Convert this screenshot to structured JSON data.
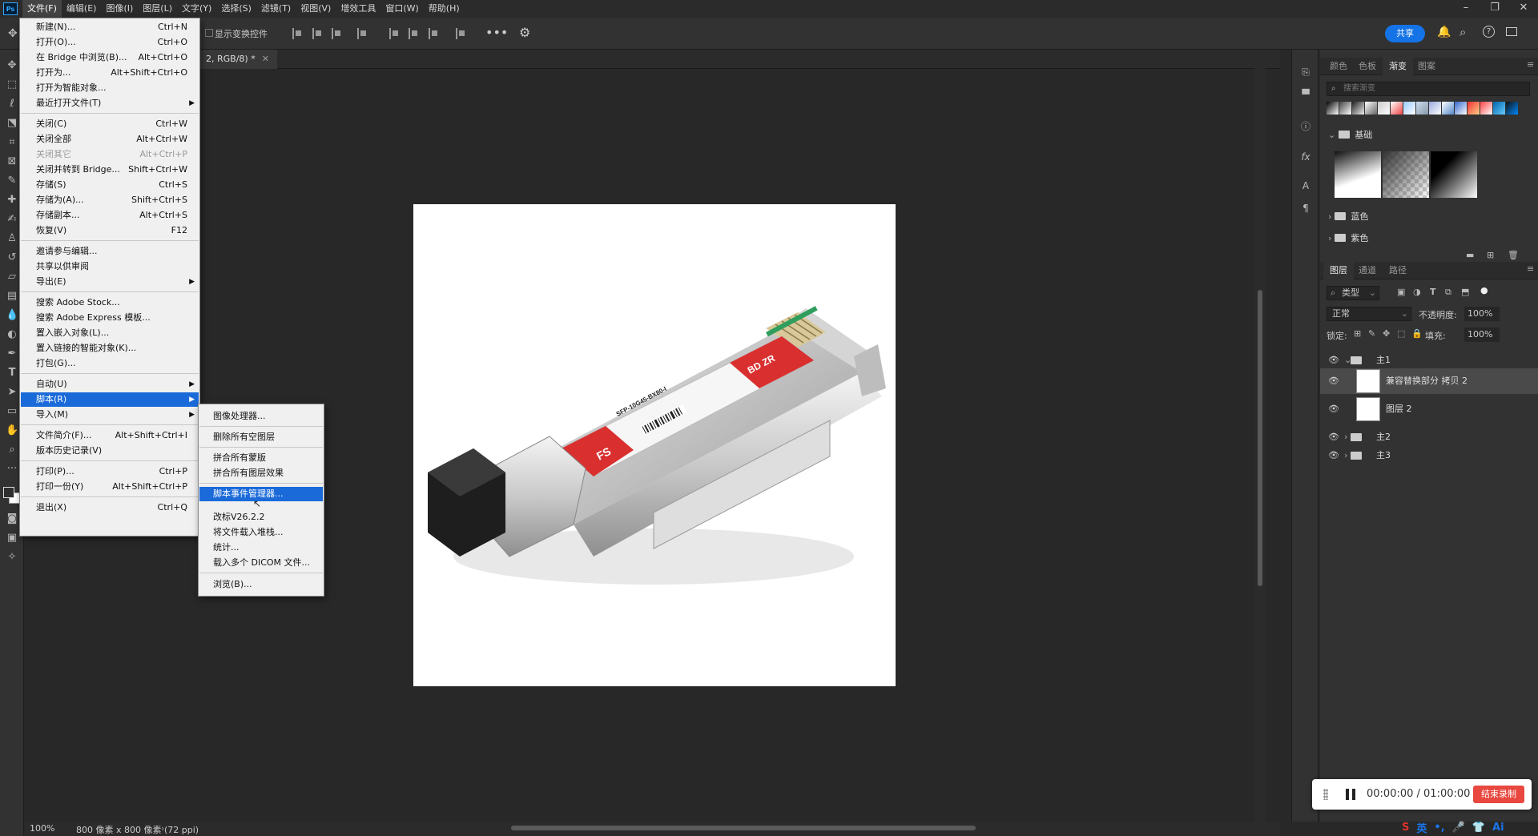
{
  "menubar": {
    "logo": "Ps",
    "items": [
      "文件(F)",
      "编辑(E)",
      "图像(I)",
      "图层(L)",
      "文字(Y)",
      "选择(S)",
      "滤镜(T)",
      "视图(V)",
      "增效工具",
      "窗口(W)",
      "帮助(H)"
    ],
    "active_index": 0
  },
  "optbar": {
    "show_transform_label": "显示变换控件",
    "share_label": "共享"
  },
  "document": {
    "tab_title": "2, RGB/8) *",
    "zoom": "100%",
    "status_info": "800 像素 x 800 像素 (72 ppi)"
  },
  "file_menu": {
    "items": [
      {
        "label": "新建(N)...",
        "shortcut": "Ctrl+N"
      },
      {
        "label": "打开(O)...",
        "shortcut": "Ctrl+O"
      },
      {
        "label": "在 Bridge 中浏览(B)...",
        "shortcut": "Alt+Ctrl+O"
      },
      {
        "label": "打开为...",
        "shortcut": "Alt+Shift+Ctrl+O"
      },
      {
        "label": "打开为智能对象...",
        "shortcut": ""
      },
      {
        "label": "最近打开文件(T)",
        "shortcut": ""
      },
      {
        "label": "关闭(C)",
        "shortcut": "Ctrl+W"
      },
      {
        "label": "关闭全部",
        "shortcut": "Alt+Ctrl+W"
      },
      {
        "label": "关闭其它",
        "shortcut": "Alt+Ctrl+P"
      },
      {
        "label": "关闭并转到 Bridge...",
        "shortcut": "Shift+Ctrl+W"
      },
      {
        "label": "存储(S)",
        "shortcut": "Ctrl+S"
      },
      {
        "label": "存储为(A)...",
        "shortcut": "Shift+Ctrl+S"
      },
      {
        "label": "存储副本...",
        "shortcut": "Alt+Ctrl+S"
      },
      {
        "label": "恢复(V)",
        "shortcut": "F12"
      },
      {
        "label": "邀请参与编辑...",
        "shortcut": ""
      },
      {
        "label": "共享以供审阅",
        "shortcut": ""
      },
      {
        "label": "导出(E)",
        "shortcut": ""
      },
      {
        "label": "搜索 Adobe Stock...",
        "shortcut": ""
      },
      {
        "label": "搜索 Adobe Express 模板...",
        "shortcut": ""
      },
      {
        "label": "置入嵌入对象(L)...",
        "shortcut": ""
      },
      {
        "label": "置入链接的智能对象(K)...",
        "shortcut": ""
      },
      {
        "label": "打包(G)...",
        "shortcut": ""
      },
      {
        "label": "自动(U)",
        "shortcut": ""
      },
      {
        "label": "脚本(R)",
        "shortcut": ""
      },
      {
        "label": "导入(M)",
        "shortcut": ""
      },
      {
        "label": "文件简介(F)...",
        "shortcut": "Alt+Shift+Ctrl+I"
      },
      {
        "label": "版本历史记录(V)",
        "shortcut": ""
      },
      {
        "label": "打印(P)...",
        "shortcut": "Ctrl+P"
      },
      {
        "label": "打印一份(Y)",
        "shortcut": "Alt+Shift+Ctrl+P"
      },
      {
        "label": "退出(X)",
        "shortcut": "Ctrl+Q"
      }
    ]
  },
  "scripts_menu": {
    "items": [
      {
        "label": "图像处理器..."
      },
      {
        "label": "删除所有空图层"
      },
      {
        "label": "拼合所有蒙版"
      },
      {
        "label": "拼合所有图层效果"
      },
      {
        "label": "脚本事件管理器..."
      },
      {
        "label": "改标V26.2.2"
      },
      {
        "label": "将文件载入堆栈..."
      },
      {
        "label": "统计..."
      },
      {
        "label": "载入多个 DICOM 文件..."
      },
      {
        "label": "浏览(B)..."
      }
    ]
  },
  "gradients_panel": {
    "tabs": [
      "颜色",
      "色板",
      "渐变",
      "图案"
    ],
    "search_placeholder": "搜索渐变",
    "groups": [
      "基础",
      "蓝色",
      "紫色"
    ]
  },
  "layers_panel": {
    "tabs": [
      "图层",
      "通道",
      "路径"
    ],
    "filter_label": "类型",
    "blend_mode": "正常",
    "opacity_label": "不透明度:",
    "opacity_value": "100%",
    "lock_label": "锁定:",
    "fill_label": "填充:",
    "fill_value": "100%",
    "layers": [
      {
        "name": "主1",
        "kind": "group"
      },
      {
        "name": "兼容替换部分 拷贝 2",
        "kind": "layer"
      },
      {
        "name": "图层 2",
        "kind": "layer"
      },
      {
        "name": "主2",
        "kind": "group"
      },
      {
        "name": "主3",
        "kind": "group"
      }
    ]
  },
  "recorder": {
    "time": "00:00:00 / 01:00:00",
    "stop_label": "结束录制"
  },
  "ime": {
    "lang": "英"
  },
  "product_label": {
    "brand": "FS",
    "model": "SFP-10G45-BX80-I",
    "tag": "BD ZR"
  }
}
